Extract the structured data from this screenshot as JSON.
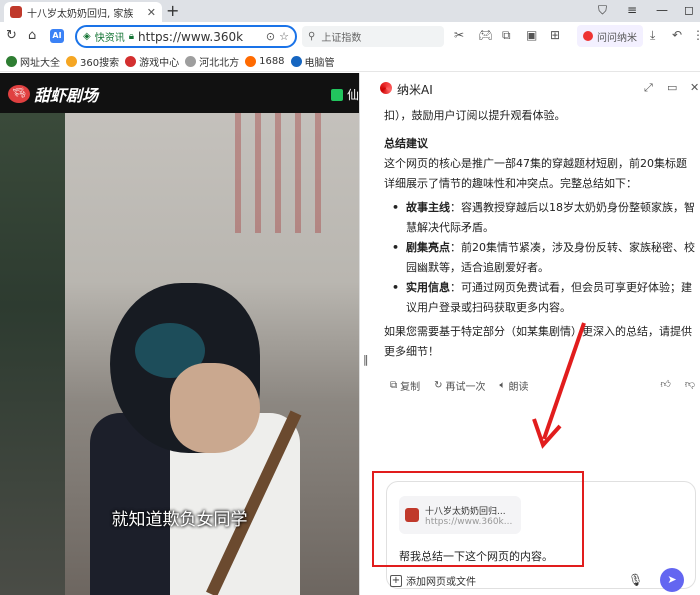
{
  "browser": {
    "tab_title": "十八岁太奶奶回归, 家族",
    "tab_close": "✕",
    "new_tab": "+",
    "omnibox_badge": "快资讯",
    "url": "https://www.360k",
    "search_placeholder": "上证指数",
    "wenwen_label": "问问纳米"
  },
  "bookmarks": [
    {
      "label": "网址大全",
      "color": "#2e7d32"
    },
    {
      "label": "360搜索",
      "color": "#f5a623"
    },
    {
      "label": "游戏中心",
      "color": "#d32f2f"
    },
    {
      "label": "河北北方",
      "color": "#9e9e9e"
    },
    {
      "label": "1688",
      "color": "#ff6a00"
    },
    {
      "label": "电脑管",
      "color": "#1565c0"
    }
  ],
  "site": {
    "name": "甜虾剧场",
    "header_button": "仙",
    "subtitle": "就知道欺负女同学"
  },
  "ai_panel": {
    "title": "纳米AI",
    "intro_tail": "扣），鼓励用户订阅以提升观看体验。",
    "summary_heading": "总结建议",
    "summary_para": "这个网页的核心是推广一部47集的穿越题材短剧，前20集标题详细展示了情节的趣味性和冲突点。完整总结如下：",
    "bullets": [
      {
        "bold": "故事主线",
        "text": "：容遇教授穿越后以18岁太奶奶身份整顿家族，智慧解决代际矛盾。"
      },
      {
        "bold": "剧集亮点",
        "text": "：前20集情节紧凑，涉及身份反转、家族秘密、校园幽默等，适合追剧爱好者。"
      },
      {
        "bold": "实用信息",
        "text": "：可通过网页免费试看，但会员可享更好体验；建议用户登录或扫码获取更多内容。"
      }
    ],
    "closing": "如果您需要基于特定部分（如某集剧情）更深入的总结，请提供更多细节！",
    "actions": {
      "copy": "复制",
      "retry": "再试一次",
      "read": "朗读"
    },
    "card_title": "十八岁太奶奶回归...",
    "card_url": "https://www.360k...",
    "prompt_text": "帮我总结一下这个网页的内容。",
    "add_web": "添加网页或文件"
  },
  "accent": {
    "highlight": "#e11d1d",
    "send": "#6366f1",
    "link": "#1a73e8"
  }
}
